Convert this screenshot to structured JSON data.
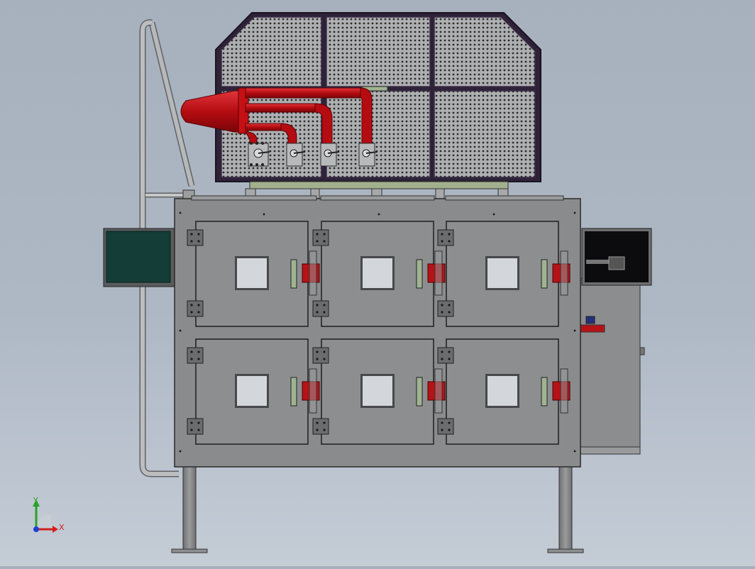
{
  "colors": {
    "background_top": "#a7b1bd",
    "cabinet_body": "#8a8b8c",
    "door": "#8d8e90",
    "mesh_panel": "#a9aaac",
    "frame": "#3b2b44",
    "pipe_red": "#c41015",
    "display_green": "#133d36",
    "axis_x": "#d21f1f",
    "axis_y": "#26a326",
    "axis_z": "#1d3fd6"
  },
  "triad": {
    "x_label": "X",
    "y_label": "Y"
  },
  "model": {
    "door_count": 6,
    "cabinet_row_count": 2,
    "cabinet_column_count": 3
  }
}
